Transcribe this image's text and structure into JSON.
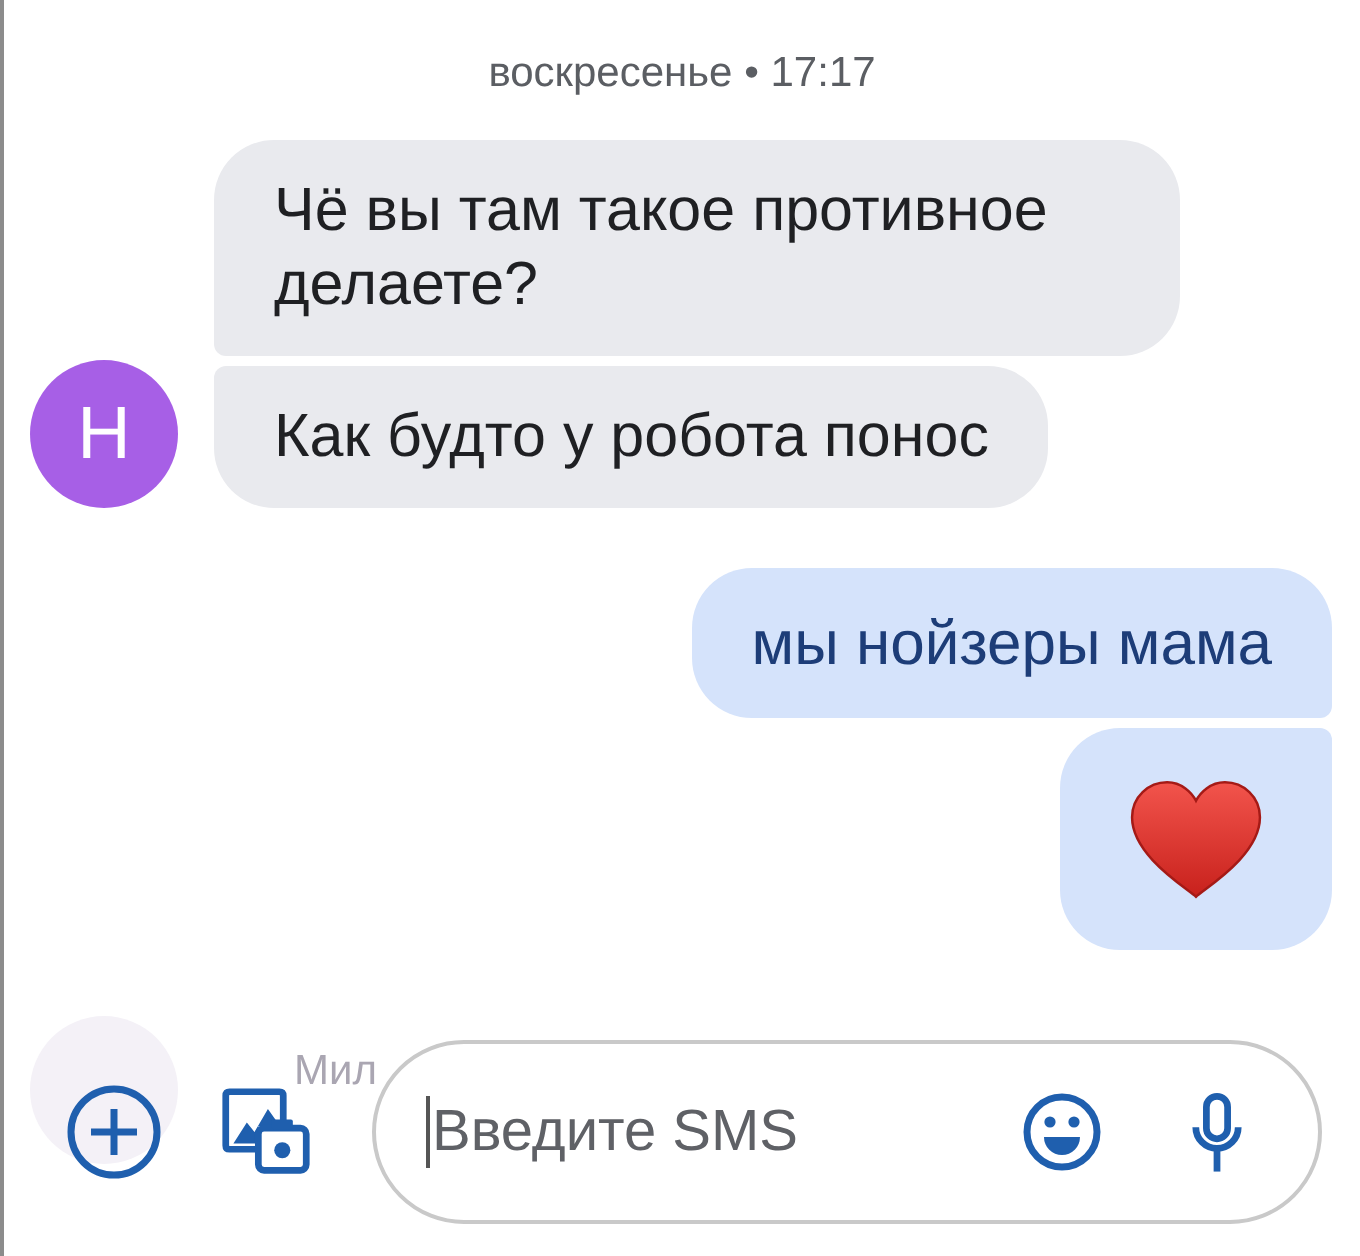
{
  "date_header": "воскресенье • 17:17",
  "conversation": [
    {
      "kind": "incoming",
      "avatar": {
        "letter": "Н",
        "color": "#a75fe6"
      },
      "messages": [
        {
          "kind": "text",
          "text": "Чё вы там такое противное делаете?"
        },
        {
          "kind": "text",
          "text": "Как будто у робота понос"
        }
      ]
    },
    {
      "kind": "outgoing",
      "messages": [
        {
          "kind": "text",
          "text": "мы нойзеры мама"
        },
        {
          "kind": "heart"
        }
      ]
    }
  ],
  "faded_preview": {
    "name": "Мил"
  },
  "composer": {
    "placeholder": "Введите SMS",
    "focused": true
  }
}
